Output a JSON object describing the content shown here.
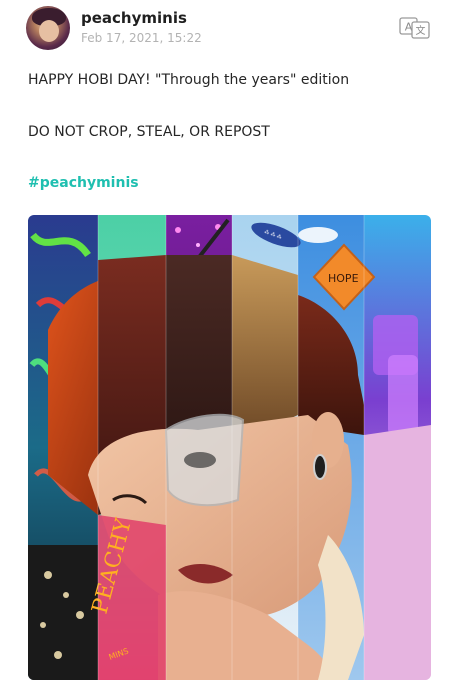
{
  "post": {
    "username": "peachyminis",
    "timestamp": "Feb 17, 2021, 15:22",
    "line1": "HAPPY HOBI DAY! \"Through the years\" edition",
    "line2": "DO NOT CROP, STEAL, OR REPOST",
    "hashtag": "#peachyminis"
  },
  "artwork": {
    "sign_text": "HOPE",
    "signature_main": "PEACHY",
    "signature_sub": "MINS"
  },
  "icons": {
    "avatar": "profile-avatar",
    "translate": "translate-icon"
  }
}
